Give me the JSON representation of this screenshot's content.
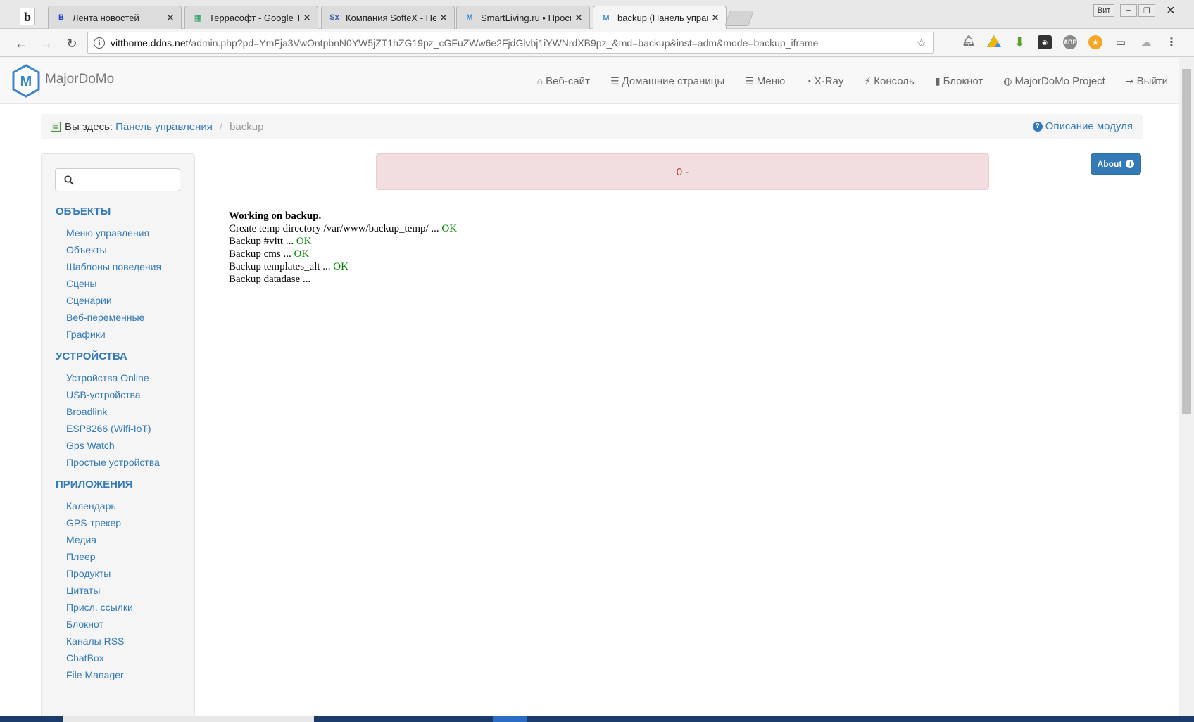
{
  "browser": {
    "tabs": [
      {
        "title": "Лента новостей",
        "fav_glyph": "B",
        "fav_color": "#1a3fd1"
      },
      {
        "title": "Террасофт - Google Таб",
        "fav_glyph": "▦",
        "fav_color": "#0f9d58"
      },
      {
        "title": "Компания SofteX - Help",
        "fav_glyph": "Sx",
        "fav_color": "#3b5ca8"
      },
      {
        "title": "SmartLiving.ru • Просмо",
        "fav_glyph": "M",
        "fav_color": "#3a8fd1"
      },
      {
        "title": "backup (Панель управл",
        "fav_glyph": "M",
        "fav_color": "#3a8fd1"
      }
    ],
    "window_user": "Вит",
    "url_host": "vitthome.ddns.net",
    "url_path": "/admin.php?pd=YmFja3VwOntpbnN0YW5jZT1hZG19pz_cGFuZWw6e2FjdGlvbj1iYWNrdXB9pz_&md=backup&inst=adm&mode=backup_iframe"
  },
  "brand": {
    "name": "MajorDoMo"
  },
  "nav": [
    {
      "icon": "home-icon",
      "glyph": "⌂",
      "label": "Веб-сайт"
    },
    {
      "icon": "list-icon",
      "glyph": "☰",
      "label": "Домашние страницы"
    },
    {
      "icon": "list-icon",
      "glyph": "☰",
      "label": "Меню"
    },
    {
      "icon": "dashboard-icon",
      "glyph": "◔",
      "label": "X-Ray"
    },
    {
      "icon": "flash-icon",
      "glyph": "⚡",
      "label": "Консоль"
    },
    {
      "icon": "book-icon",
      "glyph": "▮",
      "label": "Блокнот"
    },
    {
      "icon": "globe-icon",
      "glyph": "◍",
      "label": "MajorDoMo Project"
    },
    {
      "icon": "logout-icon",
      "glyph": "⇥",
      "label": "Выйти"
    }
  ],
  "breadcrumb": {
    "prefix": "Вы здесь:",
    "link": "Панель управления",
    "current": "backup",
    "help": "Описание модуля"
  },
  "sidebar": {
    "search_placeholder": "",
    "sections": [
      {
        "title": "ОБЪЕКТЫ",
        "items": [
          "Меню управления",
          "Объекты",
          "Шаблоны поведения",
          "Сцены",
          "Сценарии",
          "Веб-переменные",
          "Графики"
        ]
      },
      {
        "title": "УСТРОЙСТВА",
        "items": [
          "Устройства Online",
          "USB-устройства",
          "Broadlink",
          "ESP8266 (Wifi-IoT)",
          "Gps Watch",
          "Простые устройства"
        ]
      },
      {
        "title": "ПРИЛОЖЕНИЯ",
        "items": [
          "Календарь",
          "GPS-трекер",
          "Медиа",
          "Плеер",
          "Продукты",
          "Цитаты",
          "Присл. ссылки",
          "Блокнот",
          "Каналы RSS",
          "ChatBox",
          "File Manager"
        ]
      }
    ]
  },
  "alert": {
    "text": "0 -"
  },
  "about": {
    "label": "About"
  },
  "log": {
    "header": "Working on backup.",
    "lines": [
      {
        "text": "Create temp directory /var/www/backup_temp/ ...",
        "status": "OK"
      },
      {
        "text": "Backup #vitt ...",
        "status": "OK"
      },
      {
        "text": "Backup cms ...",
        "status": "OK"
      },
      {
        "text": "Backup templates_alt ...",
        "status": "OK"
      },
      {
        "text": "Backup datadase ...",
        "status": ""
      }
    ]
  }
}
